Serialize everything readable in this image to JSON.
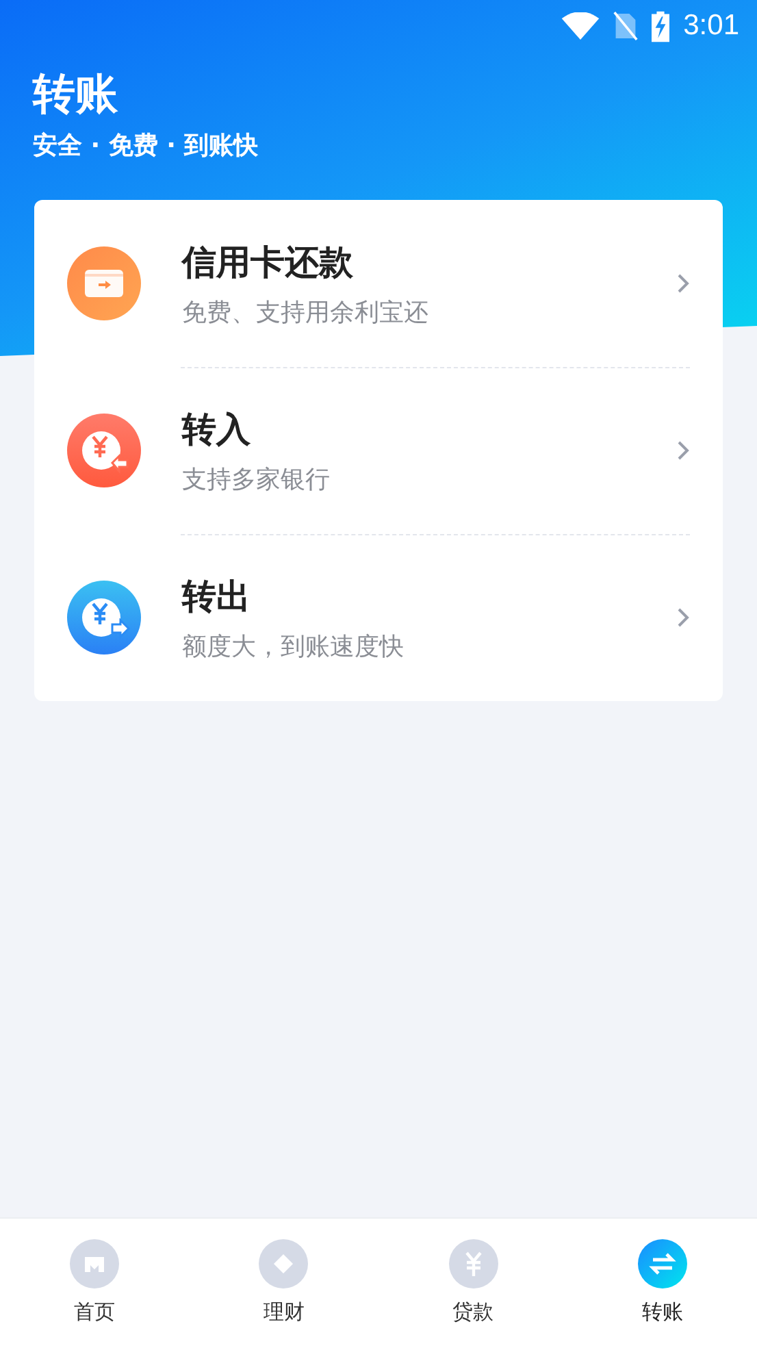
{
  "status_bar": {
    "time": "3:01"
  },
  "header": {
    "title": "转账",
    "subtitle": "安全 · 免费 · 到账快"
  },
  "items": [
    {
      "kind": "card",
      "title": "信用卡还款",
      "subtitle": "免费、支持用余利宝还"
    },
    {
      "kind": "in",
      "title": "转入",
      "subtitle": "支持多家银行"
    },
    {
      "kind": "out",
      "title": "转出",
      "subtitle": "额度大，到账速度快"
    }
  ],
  "tabs": [
    {
      "kind": "home",
      "label": "首页",
      "selected": false
    },
    {
      "kind": "wealth",
      "label": "理财",
      "selected": false
    },
    {
      "kind": "loan",
      "label": "贷款",
      "selected": false
    },
    {
      "kind": "transfer",
      "label": "转账",
      "selected": true
    }
  ]
}
